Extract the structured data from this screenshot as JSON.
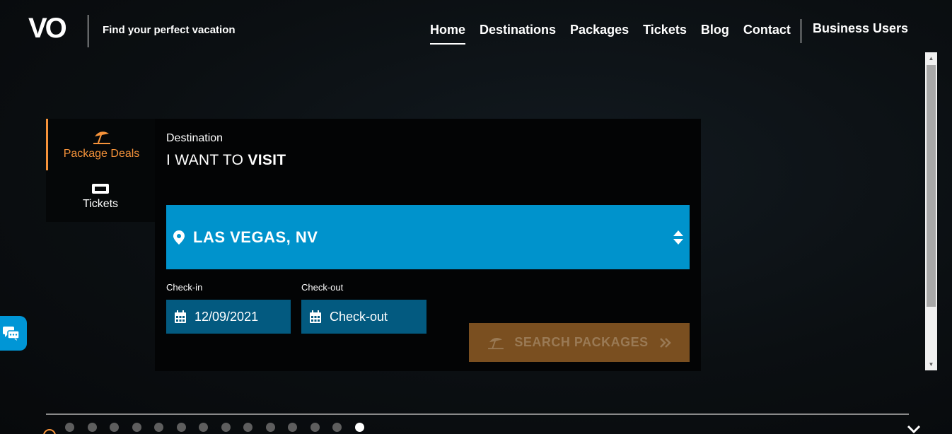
{
  "header": {
    "logo": "VO",
    "tagline": "Find your perfect vacation",
    "nav": [
      "Home",
      "Destinations",
      "Packages",
      "Tickets",
      "Blog",
      "Contact"
    ],
    "business": "Business Users"
  },
  "tabs": {
    "package": {
      "label": "Package Deals",
      "icon": "beach-umbrella-icon"
    },
    "tickets": {
      "label": "Tickets",
      "icon": "ticket-icon"
    }
  },
  "search": {
    "destination_label": "Destination",
    "heading_prefix": "I WANT TO ",
    "heading_bold": "VISIT",
    "destination_value": "LAS VEGAS, NV",
    "checkin_label": "Check-in",
    "checkin_value": "12/09/2021",
    "checkout_label": "Check-out",
    "checkout_value": "Check-out",
    "button_label": "SEARCH PACKAGES"
  },
  "colors": {
    "accent_orange": "#f7933a",
    "destination_blue": "#0093cc",
    "date_field_blue": "#035a80",
    "button_disabled": "#7a4f20"
  }
}
